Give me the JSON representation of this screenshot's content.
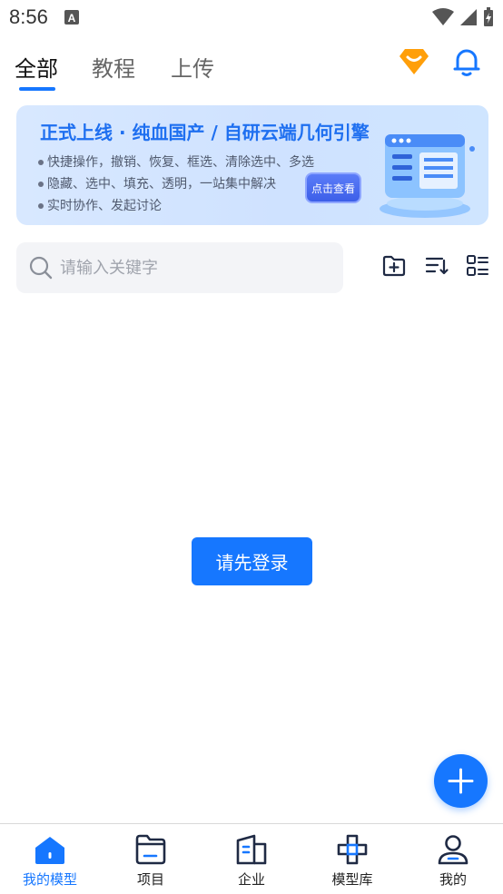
{
  "status_bar": {
    "time": "8:56"
  },
  "tabs": [
    {
      "label": "全部",
      "active": true
    },
    {
      "label": "教程",
      "active": false
    },
    {
      "label": "上传",
      "active": false
    }
  ],
  "header_icons": [
    "vip-diamond-icon",
    "bell-icon"
  ],
  "banner": {
    "title": "正式上线 · 纯血国产 / 自研云端几何引擎",
    "bullets": [
      "快捷操作，撤销、恢复、框选、清除选中、多选",
      "隐藏、选中、填充、透明，一站集中解决",
      "实时协作、发起讨论"
    ],
    "button_label": "点击查看"
  },
  "search": {
    "placeholder": "请输入关键字",
    "value": ""
  },
  "toolbar_icons": [
    "new-folder-icon",
    "sort-icon",
    "list-view-icon"
  ],
  "main": {
    "login_button_label": "请先登录"
  },
  "bottom_nav": [
    {
      "label": "我的模型",
      "icon": "home-icon",
      "active": true
    },
    {
      "label": "项目",
      "icon": "folder-icon",
      "active": false
    },
    {
      "label": "企业",
      "icon": "building-icon",
      "active": false
    },
    {
      "label": "模型库",
      "icon": "library-icon",
      "active": false
    },
    {
      "label": "我的",
      "icon": "user-icon",
      "active": false
    }
  ],
  "colors": {
    "accent": "#1677ff",
    "vip": "#ff9f0a",
    "banner_title": "#1e6ff0"
  }
}
